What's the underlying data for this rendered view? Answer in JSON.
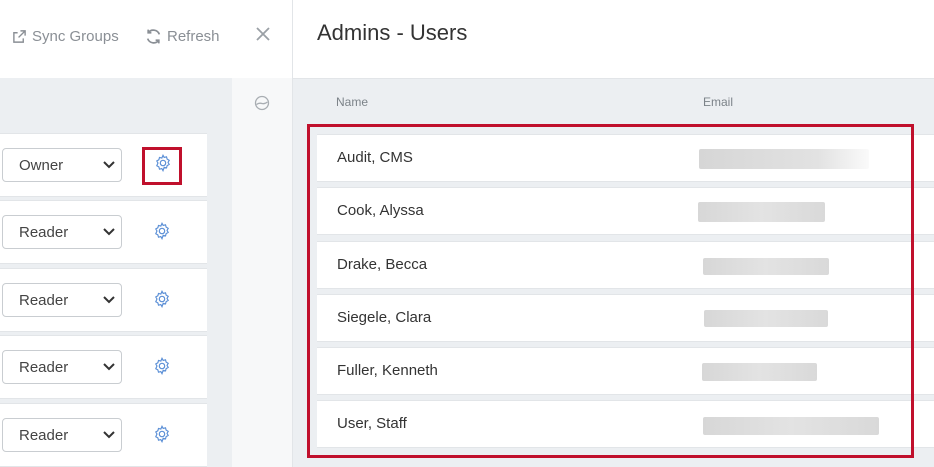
{
  "toolbar": {
    "sync_groups_label": "Sync Groups",
    "refresh_label": "Refresh"
  },
  "group_roles": [
    {
      "role": "Owner"
    },
    {
      "role": "Reader"
    },
    {
      "role": "Reader"
    },
    {
      "role": "Reader"
    },
    {
      "role": "Reader"
    }
  ],
  "panel": {
    "title": "Admins - Users",
    "columns": {
      "name": "Name",
      "email": "Email"
    }
  },
  "users": [
    {
      "name": "Audit, CMS"
    },
    {
      "name": "Cook, Alyssa"
    },
    {
      "name": "Drake, Becca"
    },
    {
      "name": "Siegele, Clara"
    },
    {
      "name": "Fuller, Kenneth"
    },
    {
      "name": "User, Staff"
    }
  ],
  "icons": {
    "sync": "external-link-icon",
    "refresh": "refresh-icon",
    "close": "close-icon",
    "settings": "gear-icon",
    "collapse": "collapse-icon",
    "dropdown": "chevron-down-icon"
  },
  "colors": {
    "highlight": "#c0102c",
    "gear": "#5b8fd6",
    "muted_text": "#8a8f95"
  }
}
